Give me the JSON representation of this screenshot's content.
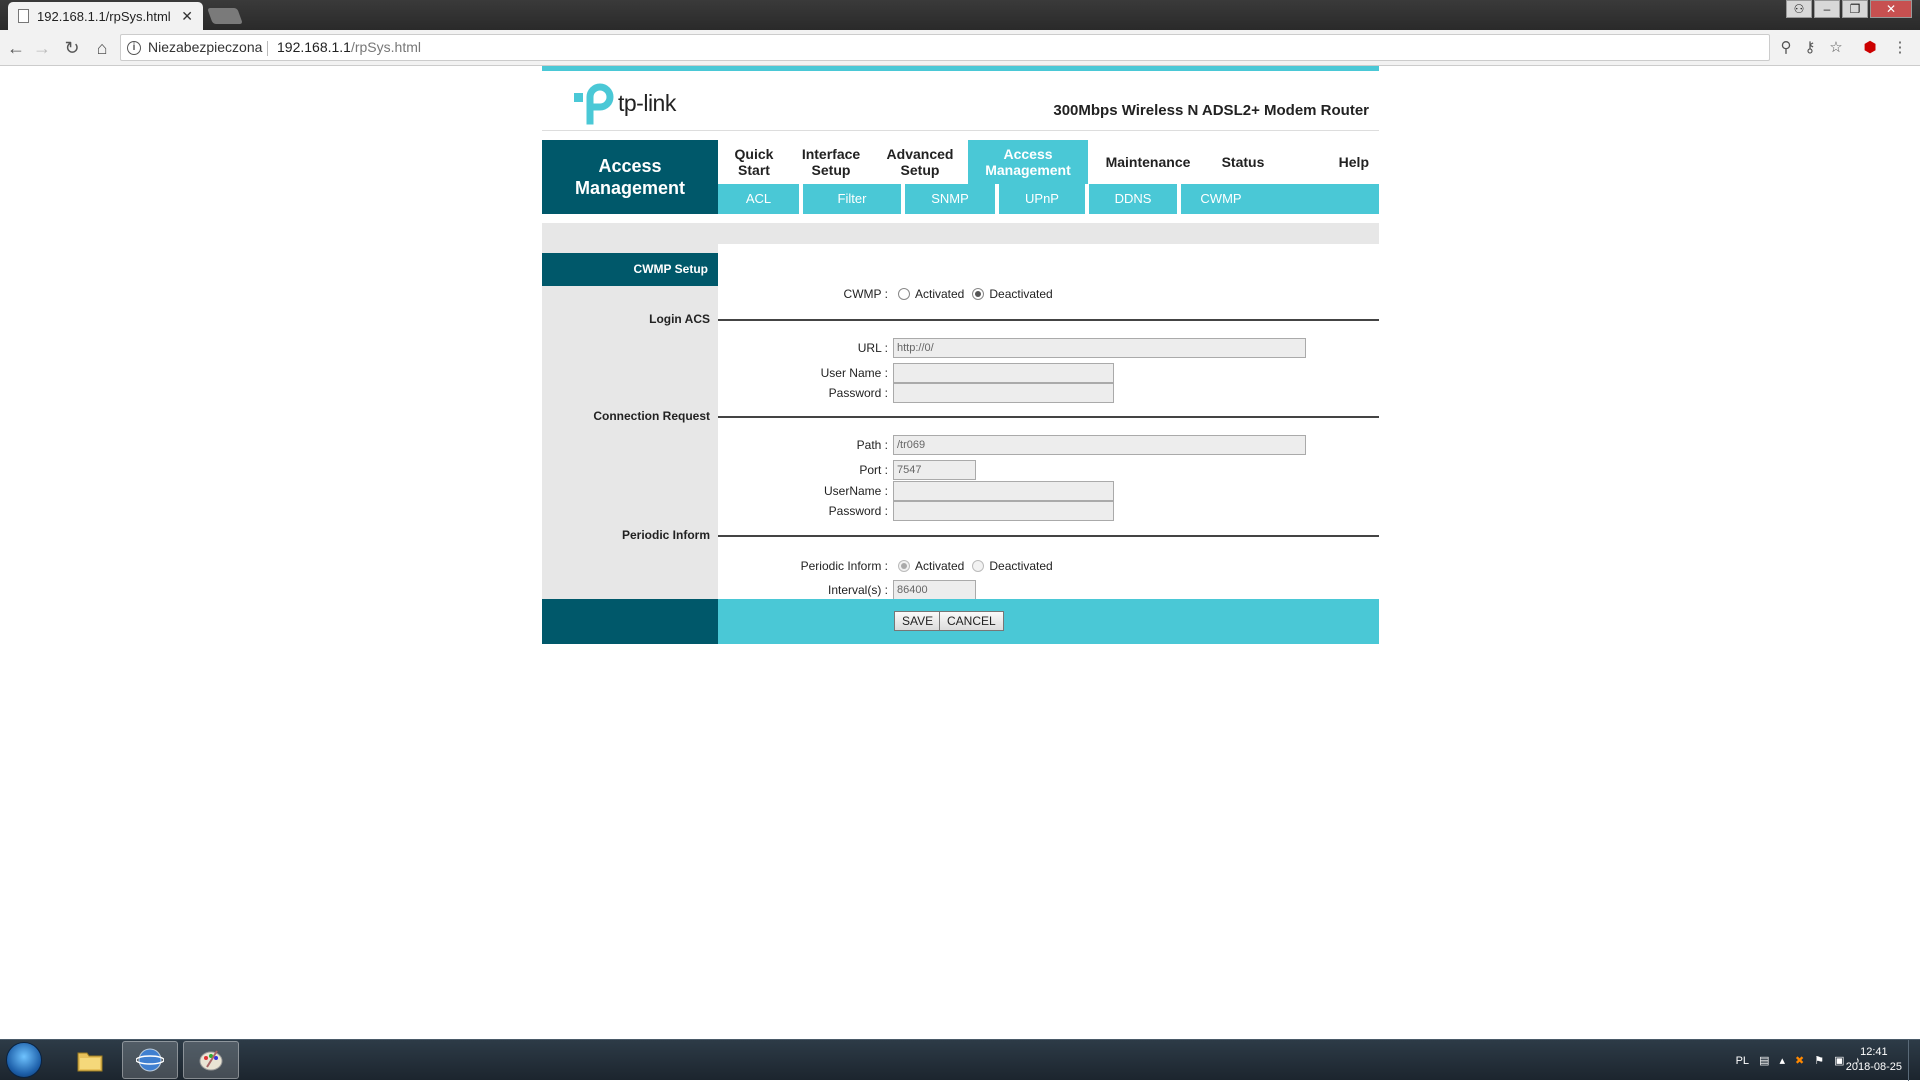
{
  "browser": {
    "tab_title": "192.168.1.1/rpSys.html",
    "tab_close": "✕",
    "security_label": "Niezabezpieczona",
    "url_host": "192.168.1.1",
    "url_path": "/rpSys.html"
  },
  "router": {
    "brand": "tp-link",
    "model": "300Mbps Wireless N ADSL2+ Modem Router",
    "section_title": "Access Management",
    "menu": [
      {
        "label": "Quick Start"
      },
      {
        "label": "Interface Setup"
      },
      {
        "label": "Advanced Setup"
      },
      {
        "label": "Access Management"
      },
      {
        "label": "Maintenance"
      },
      {
        "label": "Status"
      },
      {
        "label": "Help"
      }
    ],
    "submenu": [
      {
        "label": "ACL"
      },
      {
        "label": "Filter"
      },
      {
        "label": "SNMP"
      },
      {
        "label": "UPnP"
      },
      {
        "label": "DDNS"
      },
      {
        "label": "CWMP"
      }
    ],
    "page_label": "CWMP Setup",
    "cwmp": {
      "label": "CWMP :",
      "activated": "Activated",
      "deactivated": "Deactivated",
      "selected": "Deactivated"
    },
    "login_acs": {
      "title": "Login ACS",
      "url_label": "URL :",
      "url_value": "http://0/",
      "username_label": "User Name :",
      "username_value": "",
      "password_label": "Password :",
      "password_value": ""
    },
    "connection_request": {
      "title": "Connection Request",
      "path_label": "Path :",
      "path_value": "/tr069",
      "port_label": "Port :",
      "port_value": "7547",
      "username_label": "UserName :",
      "username_value": "",
      "password_label": "Password :",
      "password_value": ""
    },
    "periodic_inform": {
      "title": "Periodic Inform",
      "label": "Periodic Inform :",
      "activated": "Activated",
      "deactivated": "Deactivated",
      "selected": "Activated",
      "interval_label": "Interval(s) :",
      "interval_value": "86400"
    },
    "buttons": {
      "save": "SAVE",
      "cancel": "CANCEL"
    }
  },
  "taskbar": {
    "language": "PL",
    "time": "12:41",
    "date": "2018-08-25"
  },
  "colors": {
    "accent": "#4ac8d6",
    "dark_teal": "#00586a",
    "panel_gray": "#e7e7e7"
  }
}
